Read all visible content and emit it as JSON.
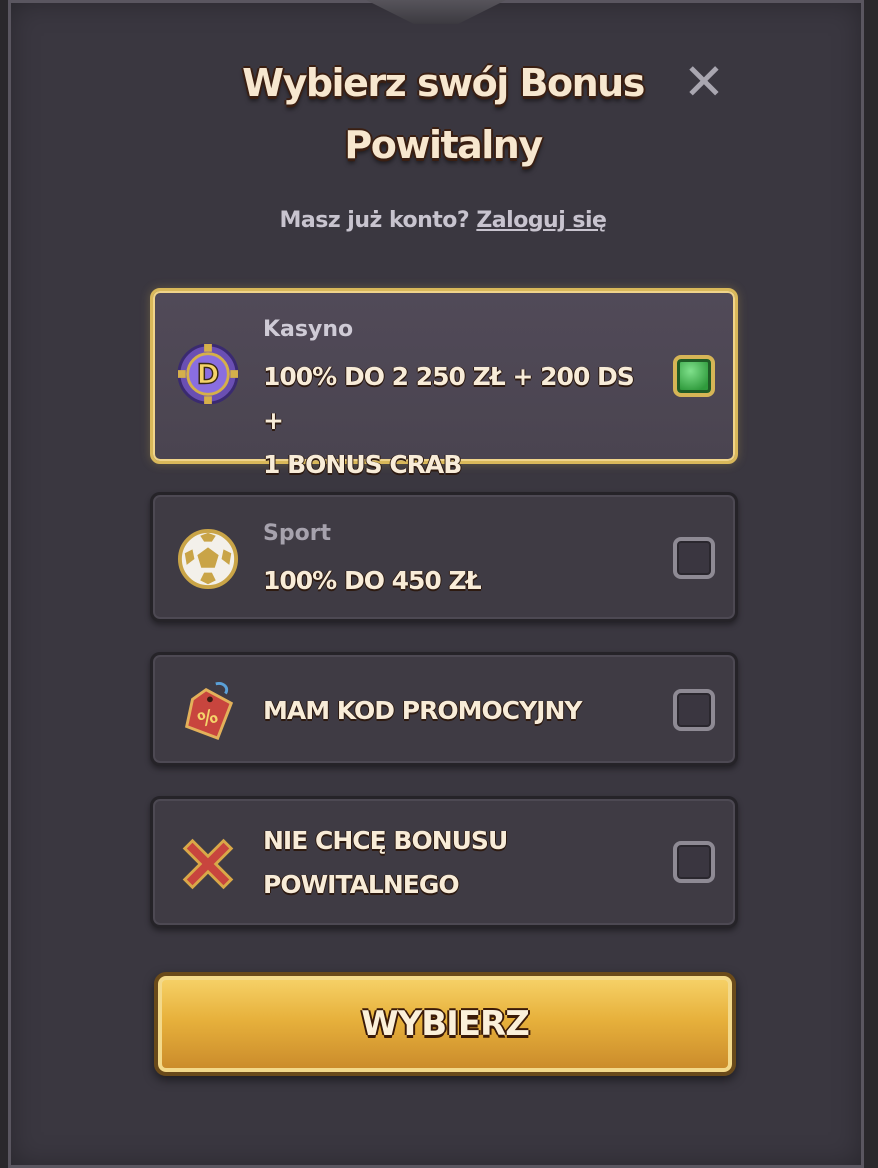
{
  "modal": {
    "title_line1": "Wybierz swój Bonus",
    "title_line2": "Powitalny",
    "login_prompt": "Masz już konto?",
    "login_link": "Zaloguj się"
  },
  "options": [
    {
      "sub": "Kasyno",
      "line1": "100% DO 2 250 ZŁ + 200 DS +",
      "line2": "1 BONUS CRAB",
      "icon": "casino-chip-icon",
      "selected": true
    },
    {
      "sub": "Sport",
      "line1": "100% DO 450 ZŁ",
      "icon": "soccer-ball-icon",
      "selected": false
    },
    {
      "line1": "MAM KOD PROMOCYJNY",
      "icon": "percent-tag-icon",
      "selected": false
    },
    {
      "line1": "NIE CHCĘ BONUSU",
      "line2": "POWITALNEGO",
      "icon": "cross-icon",
      "selected": false
    }
  ],
  "submit_label": "WYBIERZ",
  "colors": {
    "panel": "#3a3740",
    "accent_gold": "#d9b85a",
    "check_green": "#2f9a3c"
  }
}
